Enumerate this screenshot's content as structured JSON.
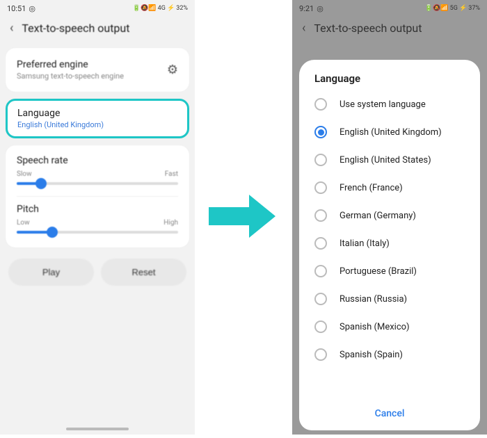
{
  "left": {
    "status": {
      "time": "10:51",
      "clock_glyph": "◎",
      "icons": "🔋🔕📶 4G ⚡",
      "battery": "32%"
    },
    "header": {
      "title": "Text-to-speech output"
    },
    "engine": {
      "label": "Preferred engine",
      "sub": "Samsung text-to-speech engine"
    },
    "language": {
      "label": "Language",
      "sub": "English (United Kingdom)"
    },
    "rate": {
      "label": "Speech rate",
      "low": "Slow",
      "high": "Fast",
      "value_pct": 15
    },
    "pitch": {
      "label": "Pitch",
      "low": "Low",
      "high": "High",
      "value_pct": 22
    },
    "buttons": {
      "play": "Play",
      "reset": "Reset"
    }
  },
  "right": {
    "status": {
      "time": "9:21",
      "clock_glyph": "◎",
      "icons": "🔋🔕📶 5G ⚡",
      "battery": "37%"
    },
    "header": {
      "title": "Text-to-speech output"
    },
    "dialog": {
      "title": "Language",
      "options": [
        "Use system language",
        "English (United Kingdom)",
        "English (United States)",
        "French (France)",
        "German (Germany)",
        "Italian (Italy)",
        "Portuguese (Brazil)",
        "Russian (Russia)",
        "Spanish (Mexico)",
        "Spanish (Spain)"
      ],
      "selected_index": 1,
      "cancel": "Cancel"
    }
  }
}
